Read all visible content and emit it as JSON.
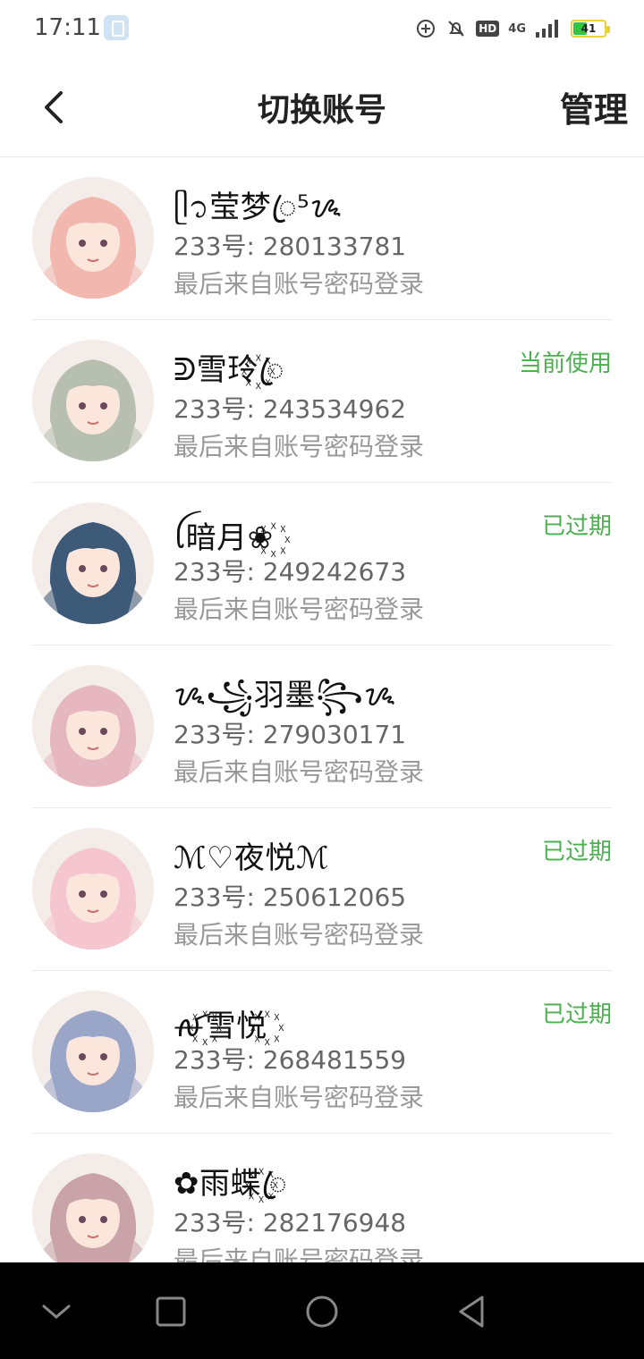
{
  "status": {
    "time": "17:11",
    "hd": "HD",
    "network": "4G",
    "battery": "41",
    "battery_level": 0.41
  },
  "header": {
    "title": "切换账号",
    "manage_label": "管理",
    "back_icon": "chevron-left-icon"
  },
  "accounts": [
    {
      "nickname": "ᥫ᭡莹梦ꦿ⁵ᝰ",
      "id_text": "233号: 280133781",
      "source": "最后来自账号密码登录",
      "badge": "",
      "avatar_color": "#f2b8b0"
    },
    {
      "nickname": "ᕲ雪玲꙰ꦿ",
      "id_text": "233号: 243534962",
      "source": "最后来自账号密码登录",
      "badge": "当前使用",
      "avatar_color": "#b7c0b0"
    },
    {
      "nickname": "ꪶ暗月❀꙰",
      "id_text": "233号: 249242673",
      "source": "最后来自账号密码登录",
      "badge": "已过期",
      "avatar_color": "#3d5a78"
    },
    {
      "nickname": "ᝰ꧁羽墨꧂ᝰ",
      "id_text": "233号: 279030171",
      "source": "最后来自账号密码登录",
      "badge": "",
      "avatar_color": "#e7b7bf"
    },
    {
      "nickname": "ℳ♡夜悦ℳ",
      "id_text": "233号: 250612065",
      "source": "最后来自账号密码登录",
      "badge": "已过期",
      "avatar_color": "#f5c6cf"
    },
    {
      "nickname": "ꫛ꙰雪悦꙰",
      "id_text": "233号: 268481559",
      "source": "最后来自账号密码登录",
      "badge": "已过期",
      "avatar_color": "#9aa6c8"
    },
    {
      "nickname": "✿雨蝶꙰ꦿ",
      "id_text": "233号: 282176948",
      "source": "最后来自账号密码登录",
      "badge": "",
      "avatar_color": "#c9a3a8"
    }
  ],
  "nav": {
    "down_icon": "chevron-down-icon",
    "recent_icon": "square-icon",
    "home_icon": "circle-icon",
    "back_icon": "triangle-back-icon"
  }
}
